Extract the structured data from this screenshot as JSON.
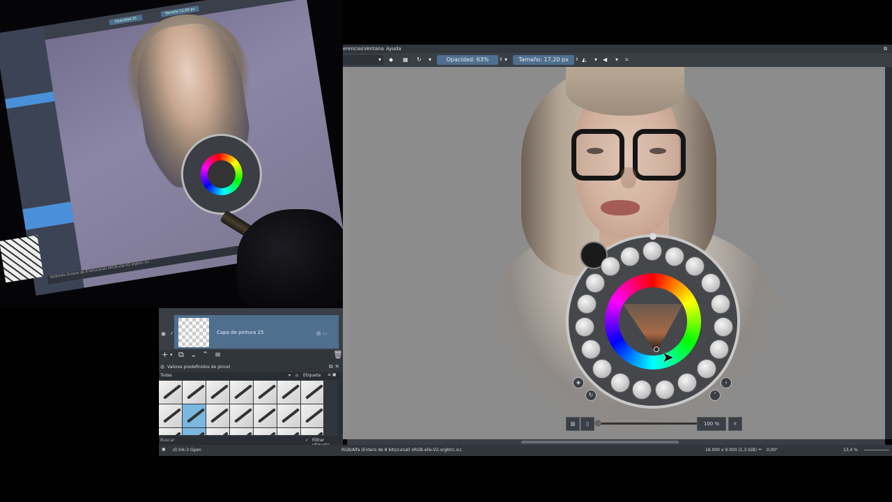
{
  "menu": {
    "item1": "erencias",
    "item2": "Ventana",
    "item3": "Ayuda"
  },
  "toolbar": {
    "opacity_label": "Opacidad: 63%",
    "size_label": "Tamaño: 17,20 px"
  },
  "layers": {
    "layer_name": "Capa de pintura 25"
  },
  "presets": {
    "title": "Valores predefinidos de pincel",
    "filter_tag": "Todas",
    "tag_label": "Etiqueta",
    "search_placeholder": "Buscar",
    "filter_label": "Filtrar etiqueta"
  },
  "statusbar": {
    "brush_name": "d) Ink-3 Gpen",
    "color_profile": "RGB/Alfa (Entero de 8 bits/canal)  sRGB-elle-V2-srgbtrc.icc",
    "canvas_size": "16.000 x 9.000 (1,3 GiB)",
    "rotation": "0,00°",
    "zoom_level": "13,4 %"
  },
  "canvas": {
    "zoom_button": "100 %"
  },
  "tablet": {
    "toolbar_opacity": "Opacidad 25",
    "toolbar_size": "Tamaño 11,00 px",
    "status_text": "RGB/Alfa (Entero de 8 bits/canal)  sRGB-elle-V2-srgbtrc.icc",
    "tag_label": "Etiqueta",
    "filter_label": "Filtrar etiqueta"
  },
  "colors": {
    "accent": "#4f6f8f",
    "panel": "#31353c",
    "canvas_bg": "#8c8c8c"
  }
}
